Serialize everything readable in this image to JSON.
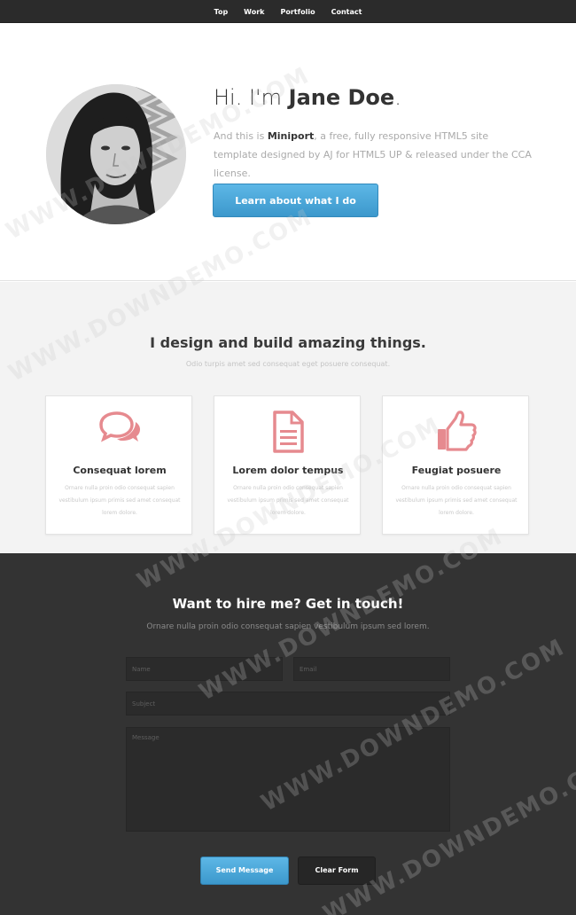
{
  "nav": {
    "items": [
      {
        "label": "Top"
      },
      {
        "label": "Work"
      },
      {
        "label": "Portfolio"
      },
      {
        "label": "Contact"
      }
    ]
  },
  "hero": {
    "greeting": "Hi. I'm ",
    "name": "Jane Doe",
    "period": ".",
    "desc_before": "And this is ",
    "desc_highlight": "Miniport",
    "desc_after": ", a free, fully responsive HTML5 site template designed by AJ for HTML5 UP & released under the CCA license.",
    "button_label": "Learn about what I do"
  },
  "work": {
    "title": "I design and build amazing things.",
    "subtitle": "Odio turpis amet sed consequat eget posuere consequat.",
    "cards": [
      {
        "icon": "comments-icon",
        "title": "Consequat lorem",
        "desc": "Ornare nulla proin odio consequat sapien vestibulum ipsum primis sed amet consequat lorem dolore."
      },
      {
        "icon": "document-icon",
        "title": "Lorem dolor tempus",
        "desc": "Ornare nulla proin odio consequat sapien vestibulum ipsum primis sed amet consequat lorem dolore."
      },
      {
        "icon": "thumbs-up-icon",
        "title": "Feugiat posuere",
        "desc": "Ornare nulla proin odio consequat sapien vestibulum ipsum primis sed amet consequat lorem dolore."
      }
    ]
  },
  "contact": {
    "title": "Want to hire me? Get in touch!",
    "subtitle": "Ornare nulla proin odio consequat sapien vestibulum ipsum sed lorem.",
    "name_placeholder": "Name",
    "email_placeholder": "Email",
    "subject_placeholder": "Subject",
    "message_placeholder": "Message",
    "send_label": "Send Message",
    "clear_label": "Clear Form"
  },
  "watermark": "WWW.DOWNDEMO.COM",
  "colors": {
    "accent": "#3c98cc",
    "icon": "#e68a8f",
    "dark": "#333333"
  }
}
